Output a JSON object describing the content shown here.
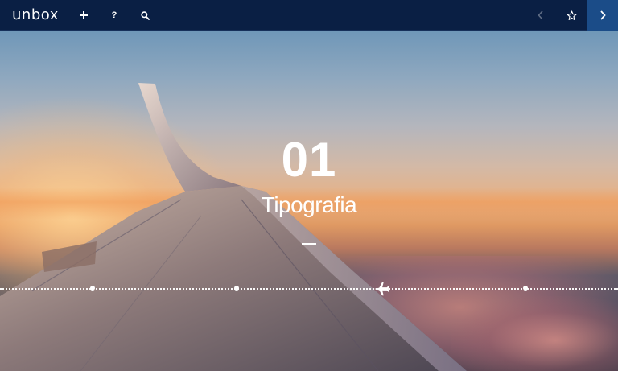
{
  "app": {
    "logo_text": "unbox"
  },
  "navbar": {
    "left_actions": [
      "add-icon",
      "help-icon",
      "search-icon"
    ],
    "help_label": "?",
    "right_actions": [
      "chevron-left-icon",
      "star-icon",
      "chevron-right-icon"
    ],
    "colors": {
      "bar": "#0a1f44",
      "active_button": "#1b4c88"
    }
  },
  "slide": {
    "number": "01",
    "title": "Tipografia"
  },
  "timeline": {
    "stops": 5,
    "current_stop": 3,
    "current_marker_icon": "airplane-icon"
  }
}
